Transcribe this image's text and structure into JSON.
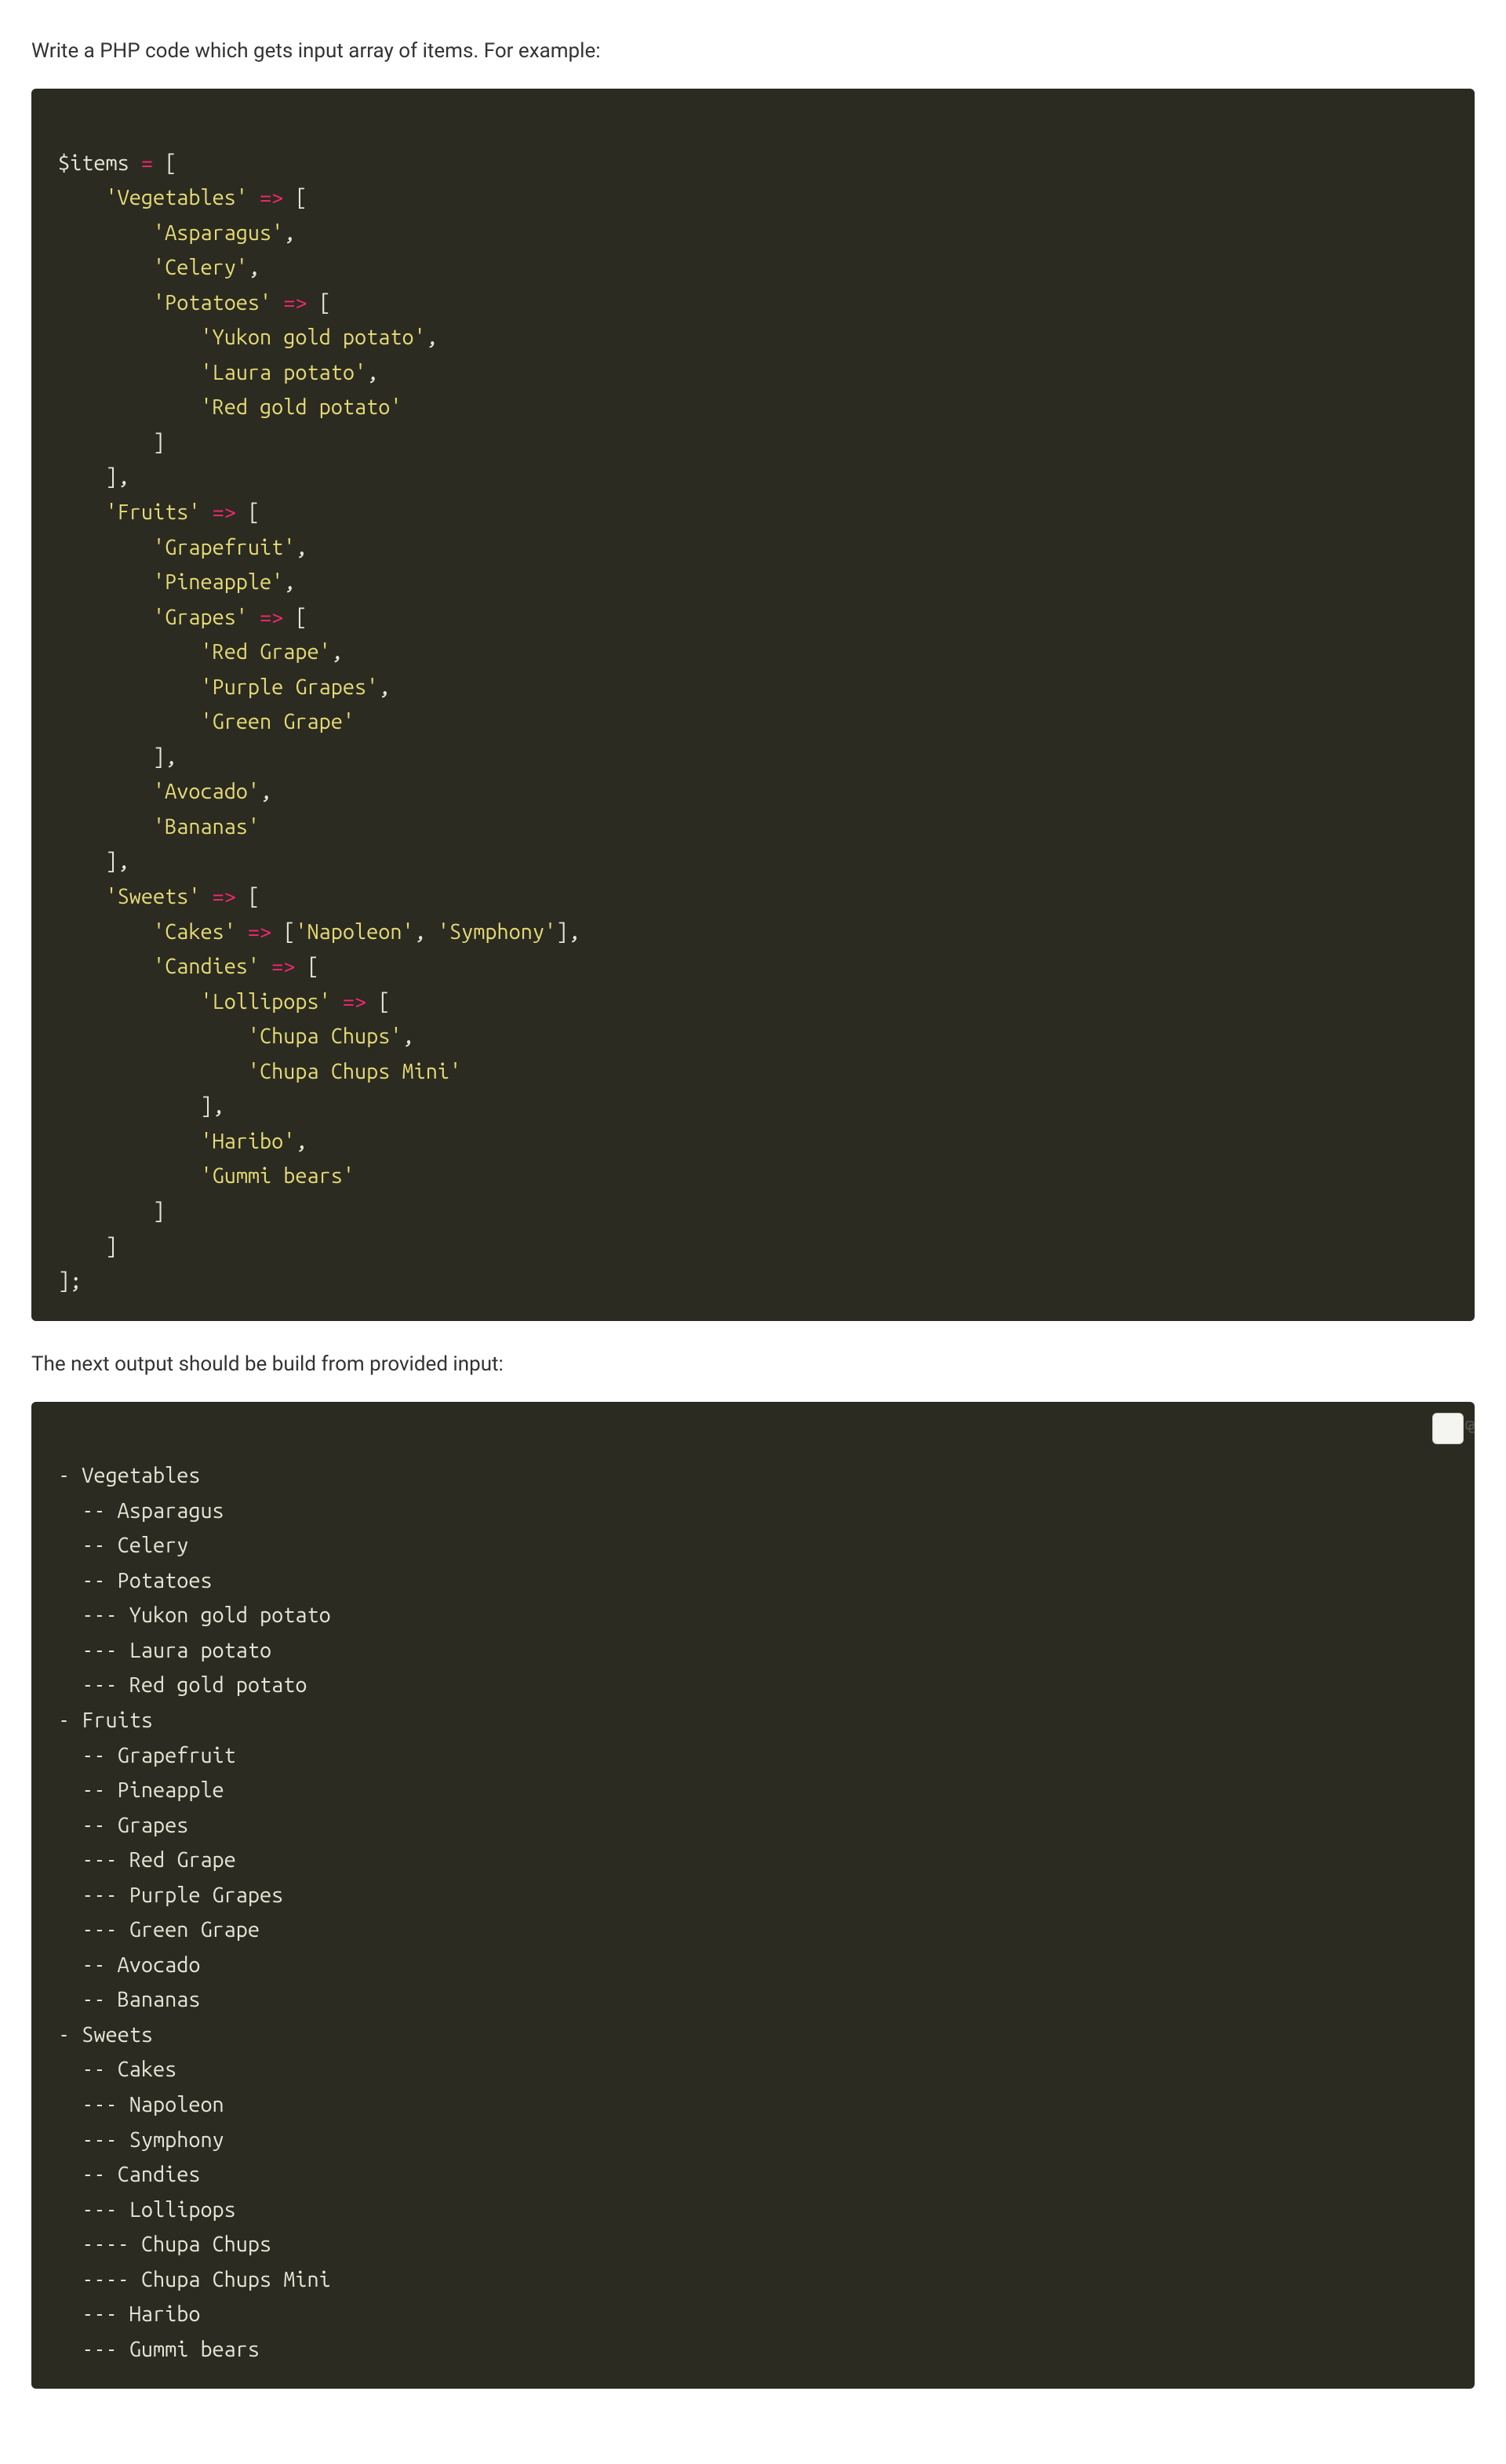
{
  "intro": "Write a PHP code which gets input array of items. For example:",
  "mid": "The next output should be build from provided input:",
  "php": {
    "l1": {
      "v": "$items ",
      "op": "=",
      "p": " ["
    },
    "l2": {
      "s": "'Vegetables'",
      "op": " => ",
      "p": "["
    },
    "l3": {
      "s": "'Asparagus'",
      "p": ","
    },
    "l4": {
      "s": "'Celery'",
      "p": ","
    },
    "l5": {
      "s": "'Potatoes'",
      "op": " => ",
      "p": "["
    },
    "l6": {
      "s": "'Yukon gold potato'",
      "p": ","
    },
    "l7": {
      "s": "'Laura potato'",
      "p": ","
    },
    "l8": {
      "s": "'Red gold potato'"
    },
    "l9": {
      "p": "]"
    },
    "l10": {
      "p": "],"
    },
    "l11": {
      "s": "'Fruits'",
      "op": " => ",
      "p": "["
    },
    "l12": {
      "s": "'Grapefruit'",
      "p": ","
    },
    "l13": {
      "s": "'Pineapple'",
      "p": ","
    },
    "l14": {
      "s": "'Grapes'",
      "op": " => ",
      "p": "["
    },
    "l15": {
      "s": "'Red Grape'",
      "p": ","
    },
    "l16": {
      "s": "'Purple Grapes'",
      "p": ","
    },
    "l17": {
      "s": "'Green Grape'"
    },
    "l18": {
      "p": "],"
    },
    "l19": {
      "s": "'Avocado'",
      "p": ","
    },
    "l20": {
      "s": "'Bananas'"
    },
    "l21": {
      "p": "],"
    },
    "l22": {
      "s": "'Sweets'",
      "op": " => ",
      "p": "["
    },
    "l23a": {
      "s": "'Cakes'",
      "op": " => ",
      "p": "["
    },
    "l23b": {
      "s": "'Napoleon'",
      "p": ", "
    },
    "l23c": {
      "s": "'Symphony'",
      "p2": "],"
    },
    "l24": {
      "s": "'Candies'",
      "op": " => ",
      "p": "["
    },
    "l25": {
      "s": "'Lollipops'",
      "op": " => ",
      "p": "["
    },
    "l26": {
      "s": "'Chupa Chups'",
      "p": ","
    },
    "l27": {
      "s": "'Chupa Chups Mini'"
    },
    "l28": {
      "p": "],"
    },
    "l29": {
      "s": "'Haribo'",
      "p": ","
    },
    "l30": {
      "s": "'Gummi bears'"
    },
    "l31": {
      "p": "]"
    },
    "l32": {
      "p": "]"
    },
    "l33": {
      "p": "];"
    }
  },
  "out": {
    "l1": "- Vegetables",
    "l2": "  -- Asparagus",
    "l3": "  -- Celery",
    "l4": "  -- Potatoes",
    "l5": "  --- Yukon gold potato",
    "l6": "  --- Laura potato",
    "l7": "  --- Red gold potato",
    "l8": "- Fruits",
    "l9": "  -- Grapefruit",
    "l10": "  -- Pineapple",
    "l11": "  -- Grapes",
    "l12": "  --- Red Grape",
    "l13": "  --- Purple Grapes",
    "l14": "  --- Green Grape",
    "l15": "  -- Avocado",
    "l16": "  -- Bananas",
    "l17": "- Sweets",
    "l18": "  -- Cakes",
    "l19": "  --- Napoleon",
    "l20": "  --- Symphony",
    "l21": "  -- Candies",
    "l22": "  --- Lollipops",
    "l23": "  ---- Chupa Chups",
    "l24": "  ---- Chupa Chups Mini",
    "l25": "  --- Haribo",
    "l26": "  --- Gummi bears"
  }
}
